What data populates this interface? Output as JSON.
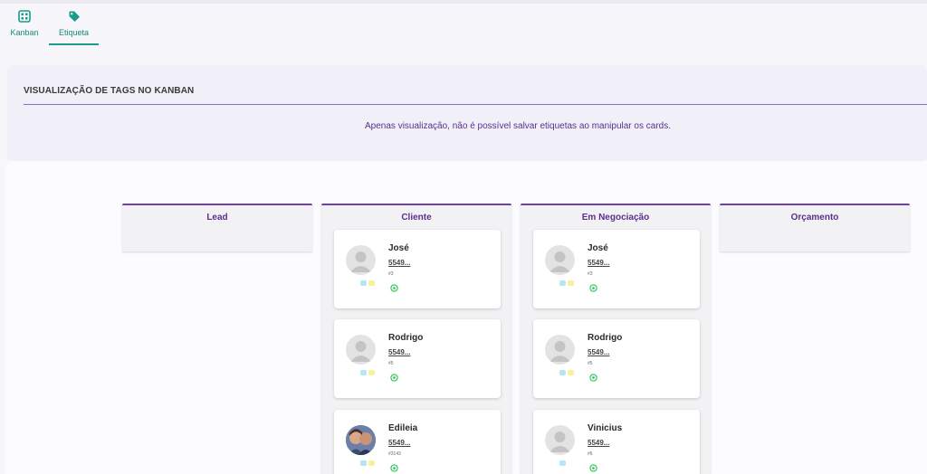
{
  "tabs": [
    {
      "label": "Kanban",
      "icon": "kanban-icon"
    },
    {
      "label": "Etiqueta",
      "icon": "tag-icon",
      "active": true
    }
  ],
  "panel": {
    "title": "VISUALIZAÇÃO DE TAGS NO KANBAN",
    "note": "Apenas visualização, não é possível salvar etiquetas ao manipular os cards."
  },
  "columns": [
    {
      "title": "Lead",
      "cards": []
    },
    {
      "title": "Cliente",
      "cards": [
        {
          "name": "José",
          "phone": "5549...",
          "id": "#3",
          "tags": [
            "#b5e6f5",
            "#f7f19a"
          ],
          "photo": false
        },
        {
          "name": "Rodrigo",
          "phone": "5549...",
          "id": "#5",
          "tags": [
            "#b5e6f5",
            "#f7f19a"
          ],
          "photo": false
        },
        {
          "name": "Edileia",
          "phone": "5549...",
          "id": "#3143",
          "tags": [
            "#b5e6f5",
            "#f7f19a"
          ],
          "photo": true
        }
      ]
    },
    {
      "title": "Em Negociação",
      "cards": [
        {
          "name": "José",
          "phone": "5549...",
          "id": "#3",
          "tags": [
            "#b5e6f5",
            "#f7f19a"
          ],
          "photo": false
        },
        {
          "name": "Rodrigo",
          "phone": "5549...",
          "id": "#5",
          "tags": [
            "#b5e6f5",
            "#f7f19a"
          ],
          "photo": false
        },
        {
          "name": "Vinicius",
          "phone": "5549...",
          "id": "#6",
          "tags": [
            "#b5e6f5"
          ],
          "photo": false
        }
      ]
    },
    {
      "title": "Orçamento",
      "cards": []
    }
  ],
  "colors": {
    "accent": "#1a9b8c",
    "column_border": "#6f3fa6",
    "whatsapp": "#2ec95b"
  }
}
